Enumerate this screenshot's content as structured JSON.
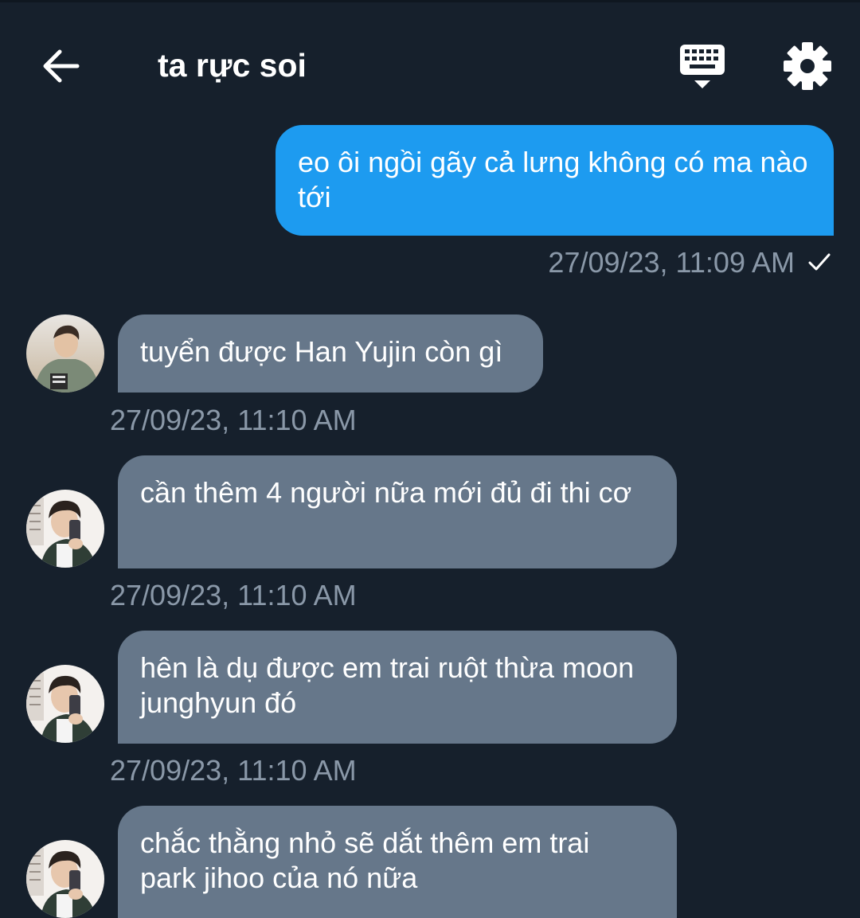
{
  "header": {
    "title": "ta rực soi",
    "back_icon": "arrow-left-icon",
    "keyboard_icon": "keyboard-icon",
    "settings_icon": "gear-icon"
  },
  "colors": {
    "background": "#16202c",
    "outgoing_bubble": "#1d9bf0",
    "incoming_bubble": "#66778a",
    "timestamp": "#8a98a8"
  },
  "messages": [
    {
      "direction": "outgoing",
      "text": "eo ôi ngồi gãy cả lưng không có ma nào tới",
      "timestamp": "27/09/23, 11:09 AM",
      "status": "✓"
    },
    {
      "direction": "incoming",
      "text": "tuyển được Han Yujin còn gì",
      "timestamp": "27/09/23, 11:10 AM",
      "avatar": "avatar-user-1"
    },
    {
      "direction": "incoming",
      "text": "cần thêm 4 người nữa mới đủ đi thi cơ",
      "timestamp": "27/09/23, 11:10 AM",
      "avatar": "avatar-user-2"
    },
    {
      "direction": "incoming",
      "text": "hên là dụ được em trai ruột thừa moon junghyun đó",
      "timestamp": "27/09/23, 11:10 AM",
      "avatar": "avatar-user-2"
    },
    {
      "direction": "incoming",
      "text": "chắc thằng nhỏ sẽ dắt thêm em trai park jihoo của nó nữa",
      "avatar": "avatar-user-2"
    }
  ]
}
